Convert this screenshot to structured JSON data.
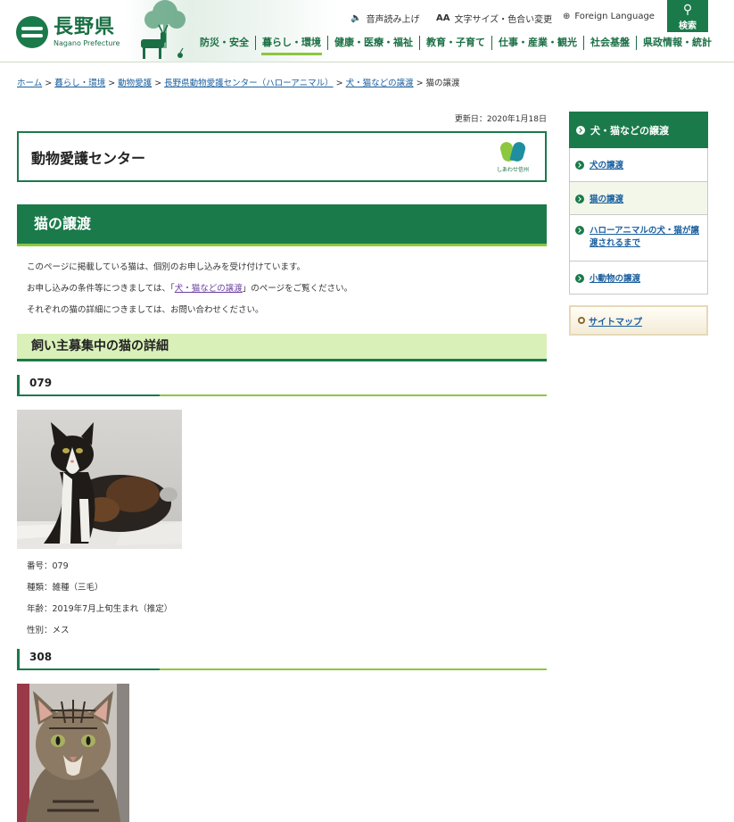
{
  "header": {
    "logo_jp": "長野県",
    "logo_en": "Nagano Prefecture",
    "utility": {
      "speech": "音声読み上げ",
      "text_size": "文字サイズ・色合い変更",
      "foreign": "Foreign Language",
      "search": "検索"
    },
    "global_nav": [
      "防災・安全",
      "暮らし・環境",
      "健康・医療・福祉",
      "教育・子育て",
      "仕事・産業・観光",
      "社会基盤",
      "県政情報・統計"
    ],
    "active_nav": "暮らし・環境"
  },
  "breadcrumb": [
    "ホーム",
    "暮らし・環境",
    "動物愛護",
    "長野県動物愛護センター（ハローアニマル）",
    "犬・猫などの譲渡",
    "猫の譲渡"
  ],
  "main": {
    "updated": "更新日：2020年1月18日",
    "center_title": "動物愛護センター",
    "shiawase_caption": "しあわせ信州",
    "page_title": "猫の譲渡",
    "intro1": "このページに掲載している猫は、個別のお申し込みを受け付けています。",
    "intro2_before": "お申し込みの条件等につきましては、「",
    "intro2_link": "犬・猫などの譲渡",
    "intro2_after": "」のページをご覧ください。",
    "intro3": "それぞれの猫の詳細につきましては、お問い合わせください。",
    "section_title": "飼い主募集中の猫の詳細",
    "cats": [
      {
        "id": "079",
        "number": "番号：079",
        "breed": "種類：雑種（三毛）",
        "age": "年齢：2019年7月上旬生まれ（推定）",
        "sex": "性別：メス"
      },
      {
        "id": "308"
      }
    ]
  },
  "sidebar": {
    "heading": "犬・猫などの譲渡",
    "items": [
      "犬の譲渡",
      "猫の譲渡",
      "ハローアニマルの犬・猫が譲渡されるまで",
      "小動物の譲渡"
    ],
    "sitemap": "サイトマップ"
  },
  "colors": {
    "brand_green": "#1a7a4a",
    "light_green": "#8dc63f",
    "section_bg": "#d9f0b8"
  }
}
